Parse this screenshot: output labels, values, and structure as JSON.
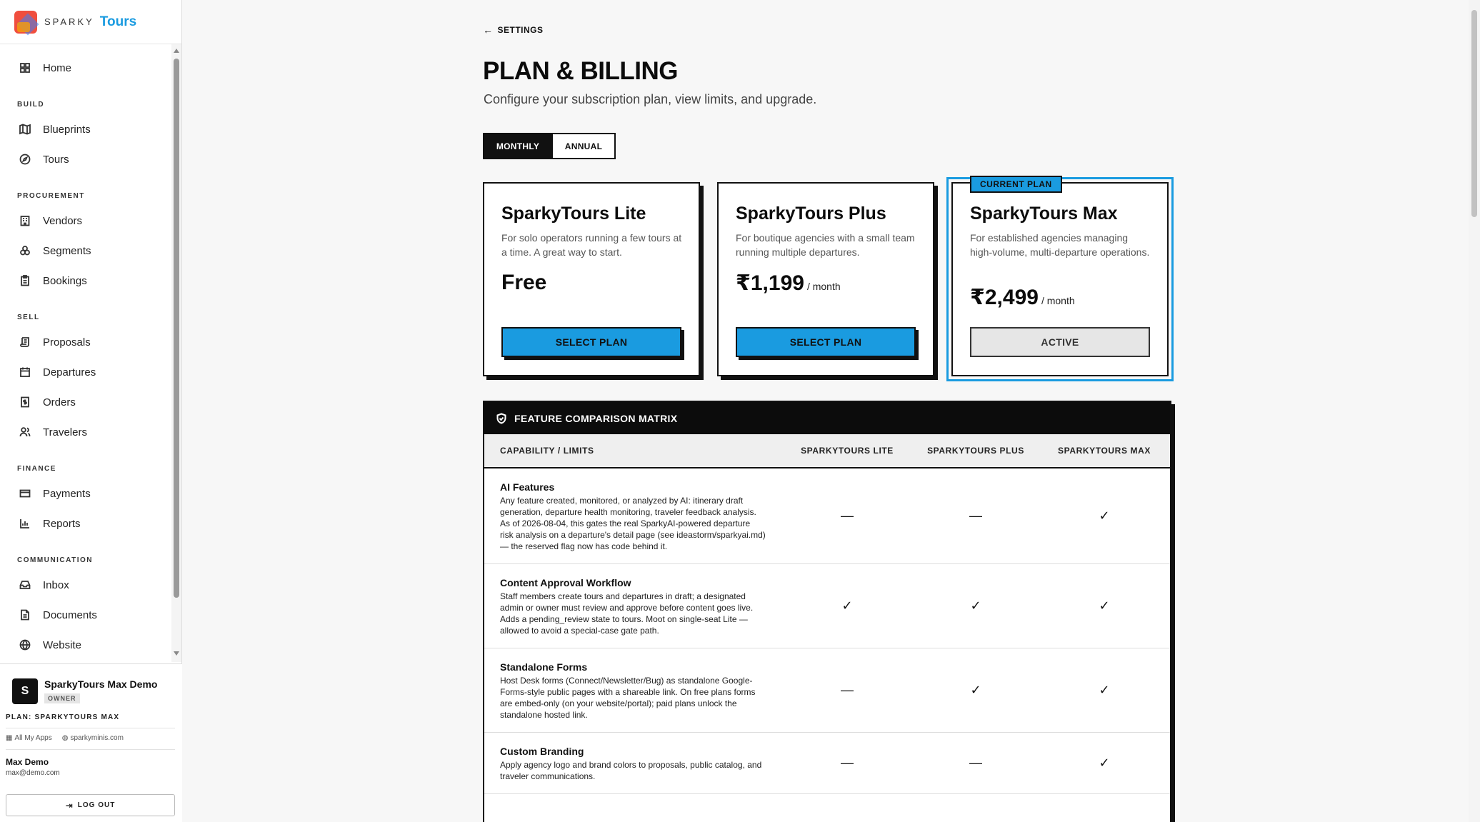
{
  "brand": {
    "sparky": "SPARKY",
    "tours": "Tours"
  },
  "nav": {
    "home": "Home",
    "sections": {
      "build": "BUILD",
      "procurement": "PROCUREMENT",
      "sell": "SELL",
      "finance": "FINANCE",
      "communication": "COMMUNICATION"
    },
    "items": {
      "blueprints": "Blueprints",
      "tours": "Tours",
      "vendors": "Vendors",
      "segments": "Segments",
      "bookings": "Bookings",
      "proposals": "Proposals",
      "departures": "Departures",
      "orders": "Orders",
      "travelers": "Travelers",
      "payments": "Payments",
      "reports": "Reports",
      "inbox": "Inbox",
      "documents": "Documents",
      "website": "Website"
    }
  },
  "account": {
    "avatar_letter": "S",
    "org_name": "SparkyTours Max Demo",
    "role": "OWNER",
    "plan_label": "PLAN: SPARKYTOURS MAX",
    "link_all_apps": "All My Apps",
    "link_site": "sparkyminis.com",
    "user_name": "Max Demo",
    "user_email": "max@demo.com",
    "logout_label": "LOG OUT"
  },
  "page": {
    "back_label": "SETTINGS",
    "title": "PLAN & BILLING",
    "subtitle": "Configure your subscription plan, view limits, and upgrade.",
    "billing_toggle": {
      "monthly": "MONTHLY",
      "annual": "ANNUAL",
      "selected": "MONTHLY"
    }
  },
  "plans": [
    {
      "name": "SparkyTours Lite",
      "description": "For solo operators running a few tours at a time. A great way to start.",
      "price": "Free",
      "period": "",
      "button": "SELECT PLAN",
      "current": false
    },
    {
      "name": "SparkyTours Plus",
      "description": "For boutique agencies with a small team running multiple departures.",
      "price": "₹1,199",
      "period": "/ month",
      "button": "SELECT PLAN",
      "current": false
    },
    {
      "name": "SparkyTours Max",
      "description": "For established agencies managing high-volume, multi-departure operations.",
      "price": "₹2,499",
      "period": "/ month",
      "button": "ACTIVE",
      "current": true,
      "badge": "CURRENT PLAN"
    }
  ],
  "matrix": {
    "title": "FEATURE COMPARISON MATRIX",
    "columns": [
      "CAPABILITY / LIMITS",
      "SPARKYTOURS LITE",
      "SPARKYTOURS PLUS",
      "SPARKYTOURS MAX"
    ],
    "rows": [
      {
        "name": "AI Features",
        "description": "Any feature created, monitored, or analyzed by AI: itinerary draft generation, departure health monitoring, traveler feedback analysis. As of 2026-08-04, this gates the real SparkyAI-powered departure risk analysis on a departure's detail page (see ideastorm/sparkyai.md) — the reserved flag now has code behind it.",
        "lite": "—",
        "plus": "—",
        "max": "✓"
      },
      {
        "name": "Content Approval Workflow",
        "description": "Staff members create tours and departures in draft; a designated admin or owner must review and approve before content goes live. Adds a pending_review state to tours. Moot on single-seat Lite — allowed to avoid a special-case gate path.",
        "lite": "✓",
        "plus": "✓",
        "max": "✓"
      },
      {
        "name": "Standalone Forms",
        "description": "Host Desk forms (Connect/Newsletter/Bug) as standalone Google-Forms-style public pages with a shareable link. On free plans forms are embed-only (on your website/portal); paid plans unlock the standalone hosted link.",
        "lite": "—",
        "plus": "✓",
        "max": "✓"
      },
      {
        "name": "Custom Branding",
        "description": "Apply agency logo and brand colors to proposals, public catalog, and traveler communications.",
        "lite": "—",
        "plus": "—",
        "max": "✓"
      }
    ]
  },
  "colors": {
    "accent": "#1a9be0",
    "ink": "#0c0c0c"
  }
}
